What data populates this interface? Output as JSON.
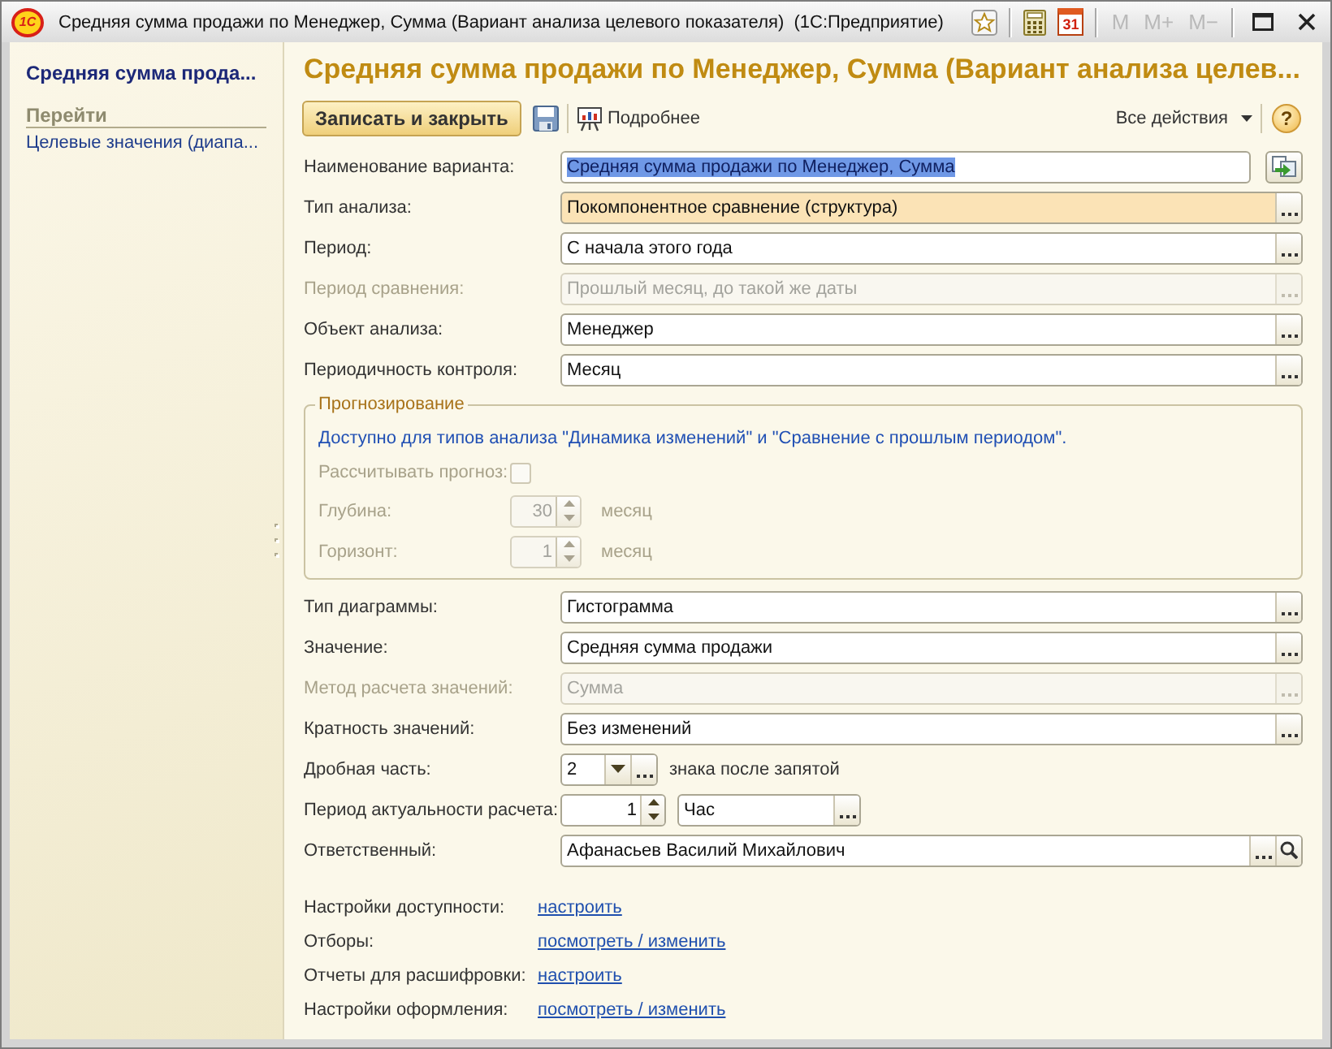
{
  "window": {
    "logo": "1С",
    "title": "Средняя сумма продажи по Менеджер, Сумма (Вариант анализа целевого показателя)  (1С:Предприятие)",
    "calendar_day": "31",
    "memory_buttons": [
      {
        "label": "M",
        "disabled": true
      },
      {
        "label": "M+",
        "disabled": true
      },
      {
        "label": "M−",
        "disabled": true
      }
    ]
  },
  "sidebar": {
    "title": "Средняя сумма прода...",
    "section": "Перейти",
    "items": [
      {
        "label": "Целевые значения (диапа...",
        "selected": false
      }
    ]
  },
  "form": {
    "title": "Средняя сумма продажи по Менеджер, Сумма (Вариант анализа целев...",
    "toolbar": {
      "save_close": "Записать и закрыть",
      "details": "Подробнее",
      "all_actions": "Все действия",
      "help": "?"
    },
    "fields": [
      {
        "kind": "text_action",
        "label": "Наименование варианта:",
        "value": "Средняя сумма продажи по Менеджер, Сумма",
        "disabled": false,
        "highlighted": false,
        "focused": true
      },
      {
        "kind": "select",
        "label": "Тип анализа:",
        "value": "Покомпонентное сравнение (структура)",
        "disabled": false,
        "highlighted": true,
        "focused": false
      },
      {
        "kind": "select",
        "label": "Период:",
        "value": "С начала этого года",
        "disabled": false,
        "highlighted": false,
        "focused": false
      },
      {
        "kind": "select",
        "label": "Период сравнения:",
        "value": "Прошлый месяц, до такой же даты",
        "disabled": true,
        "highlighted": false,
        "focused": false
      },
      {
        "kind": "select",
        "label": "Объект анализа:",
        "value": "Менеджер",
        "disabled": false,
        "highlighted": false,
        "focused": false
      },
      {
        "kind": "select",
        "label": "Периодичность контроля:",
        "value": "Месяц",
        "disabled": false,
        "highlighted": false,
        "focused": false
      }
    ],
    "forecast": {
      "title": "Прогнозирование",
      "note": "Доступно для типов анализа \"Динамика изменений\" и \"Сравнение с прошлым периодом\".",
      "checkbox": {
        "label": "Рассчитывать прогноз:",
        "checked": false,
        "disabled": true
      },
      "spinners": [
        {
          "label": "Глубина:",
          "value": "30",
          "unit": "месяц",
          "disabled": true
        },
        {
          "label": "Горизонт:",
          "value": "1",
          "unit": "месяц",
          "disabled": true
        }
      ]
    },
    "fields_after": [
      {
        "kind": "select",
        "label": "Тип диаграммы:",
        "value": "Гистограмма",
        "disabled": false,
        "highlighted": false,
        "focused": false
      },
      {
        "kind": "select",
        "label": "Значение:",
        "value": "Средняя сумма продажи",
        "disabled": false,
        "highlighted": false,
        "focused": false
      },
      {
        "kind": "select",
        "label": "Метод расчета значений:",
        "value": "Сумма",
        "disabled": true,
        "highlighted": false,
        "focused": false
      },
      {
        "kind": "select",
        "label": "Кратность значений:",
        "value": "Без изменений",
        "disabled": false,
        "highlighted": false,
        "focused": false
      },
      {
        "kind": "dropdown",
        "label": "Дробная часть:",
        "value": "2",
        "suffix": "знака после запятой",
        "disabled": false,
        "highlighted": false,
        "focused": false
      },
      {
        "kind": "spin_unit",
        "label": "Период актуальности расчета:",
        "value": "1",
        "unit": "Час",
        "disabled": false,
        "highlighted": false,
        "focused": false
      },
      {
        "kind": "search",
        "label": "Ответственный:",
        "value": "Афанасьев Василий Михайлович",
        "disabled": false,
        "highlighted": false,
        "focused": false
      }
    ],
    "links": [
      {
        "label": "Настройки доступности:",
        "link": "настроить"
      },
      {
        "label": "Отборы:",
        "link": "посмотреть / изменить"
      },
      {
        "label": "Отчеты для расшифровки:",
        "link": "настроить"
      },
      {
        "label": "Настройки оформления:",
        "link": "посмотреть / изменить"
      }
    ]
  }
}
